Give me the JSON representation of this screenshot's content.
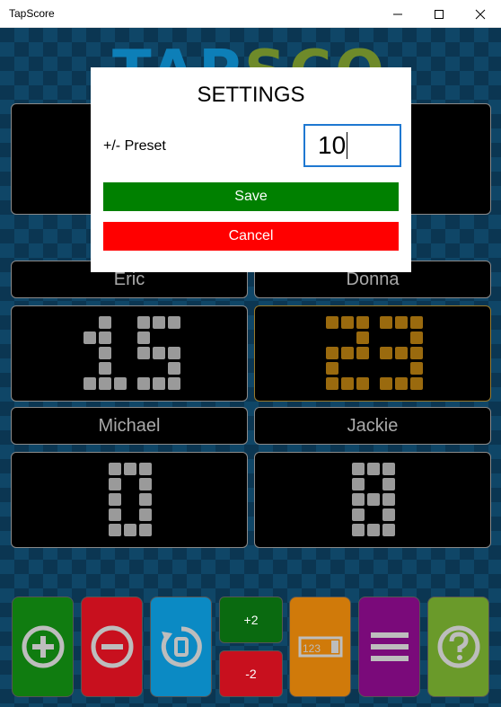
{
  "window": {
    "title": "TapScore"
  },
  "app": {
    "logo_text": "TAPSCORE",
    "players": [
      {
        "name": "Eric",
        "score": "15",
        "color": "#9a9a9a"
      },
      {
        "name": "Donna",
        "score": "23",
        "color": "#9a6a0e"
      },
      {
        "name": "Michael",
        "score": "0",
        "color": "#9a9a9a"
      },
      {
        "name": "Jackie",
        "score": "8",
        "color": "#9a9a9a"
      }
    ],
    "toolbar": {
      "plus_label": "+2",
      "minus_label": "-2",
      "colors": {
        "add": "#107c10",
        "subtract": "#c8101e",
        "reset": "#0b8ac4",
        "plus_small": "#0a6a10",
        "minus_small": "#c8101e",
        "preset": "#d07a0a",
        "menu": "#7a0a7a",
        "help": "#6a9a2a"
      }
    }
  },
  "dialog": {
    "title": "SETTINGS",
    "preset_label": "+/- Preset",
    "preset_value": "10",
    "save_label": "Save",
    "cancel_label": "Cancel",
    "save_color": "#008000",
    "cancel_color": "#ff0000"
  }
}
